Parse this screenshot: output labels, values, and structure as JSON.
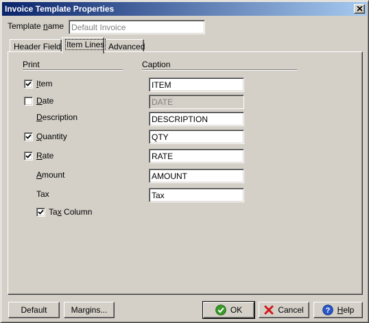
{
  "window": {
    "title": "Invoice Template Properties"
  },
  "template_name": {
    "label_pre": "Template ",
    "label_accel": "n",
    "label_post": "ame",
    "value": "Default Invoice"
  },
  "tabs": [
    {
      "label": "Header Fields",
      "active": false
    },
    {
      "label": "Item Lines",
      "active": true
    },
    {
      "label": "Advanced",
      "active": false
    }
  ],
  "columns": {
    "print": "Print",
    "caption": "Caption"
  },
  "rows": {
    "item": {
      "accel": "I",
      "rest": "tem",
      "checked": true,
      "caption": "ITEM",
      "enabled": true
    },
    "date": {
      "accel": "D",
      "rest": "ate",
      "checked": false,
      "caption": "DATE",
      "enabled": false
    },
    "description": {
      "accel": "D",
      "rest": "escription",
      "caption": "DESCRIPTION"
    },
    "quantity": {
      "accel": "Q",
      "rest": "uantity",
      "checked": true,
      "caption": "QTY"
    },
    "rate": {
      "accel": "R",
      "rest": "ate",
      "checked": true,
      "caption": "RATE"
    },
    "amount": {
      "accel": "A",
      "rest": "mount",
      "caption": "AMOUNT"
    },
    "tax": {
      "label": "Tax",
      "caption": "Tax"
    },
    "tax_column": {
      "pre": "Ta",
      "accel": "x",
      "rest": " Column",
      "checked": true
    }
  },
  "buttons": {
    "default": "Default",
    "margins": "Margins...",
    "ok": "OK",
    "cancel": "Cancel",
    "help_accel": "H",
    "help_rest": "elp"
  },
  "icons": {
    "ok": "ok-icon",
    "cancel": "cancel-icon",
    "help": "help-icon",
    "close": "close-icon",
    "check": "check-icon"
  }
}
